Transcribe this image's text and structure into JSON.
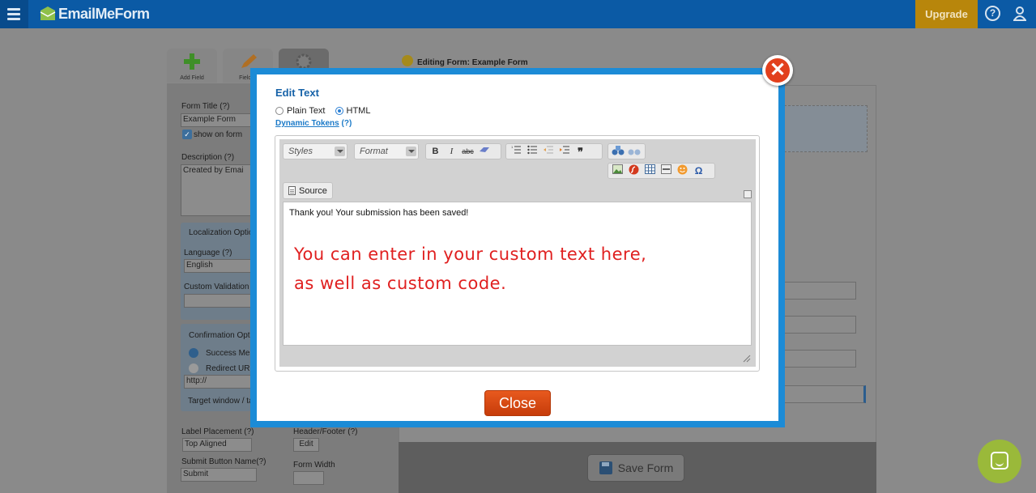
{
  "app": {
    "logo_text": "EmailMeForm",
    "upgrade_label": "Upgrade",
    "help_glyph": "?"
  },
  "background": {
    "tools": [
      {
        "label": "Add Field",
        "icon": "plus-icon"
      },
      {
        "label": "Field S",
        "icon": "pencil-icon"
      },
      {
        "label": "",
        "icon": "gear-icon"
      }
    ],
    "editing_label": "Editing Form: Example Form",
    "form_title_label": "Form Title (?)",
    "form_title_value": "Example Form",
    "show_on_form_label": "show on form",
    "description_label": "Description (?)",
    "description_value": "Created by Emai",
    "localization_label": "Localization Optio",
    "language_label": "Language (?)",
    "language_value": "English",
    "custom_validation_label": "Custom Validation",
    "confirmation_label": "Confirmation Opt",
    "success_label": "Success Mes",
    "redirect_label": "Redirect URL",
    "redirect_value": "http://",
    "target_label": "Target window / ta",
    "label_placement_label": "Label Placement (?)",
    "label_placement_value": "Top Aligned",
    "header_footer_label": "Header/Footer (?)",
    "header_footer_button": "Edit",
    "submit_name_label": "Submit Button Name(?)",
    "submit_name_value": "Submit",
    "form_width_label": "Form Width",
    "save_form_label": "Save Form"
  },
  "modal": {
    "title": "Edit Text",
    "mode_options": [
      {
        "label": "Plain Text",
        "selected": false
      },
      {
        "label": "HTML",
        "selected": true
      }
    ],
    "dynamic_tokens_label": "Dynamic Tokens",
    "dynamic_tokens_help": "(?)",
    "styles_placeholder": "Styles",
    "format_placeholder": "Format",
    "toolbar_row1": [
      "B",
      "I",
      "abc"
    ],
    "source_label": "Source",
    "body_text": "Thank you! Your submission has been saved!",
    "annotation_line1": "You can enter in your custom text here,",
    "annotation_line2": "as well as custom code.",
    "close_label": "Close",
    "close_x_glyph": "✕"
  },
  "colors": {
    "header": "#0b5aa5",
    "modal_border": "#1c8bd6",
    "close_button": "#d8470f",
    "annotation": "#e02020",
    "chat": "#9ab93a"
  }
}
